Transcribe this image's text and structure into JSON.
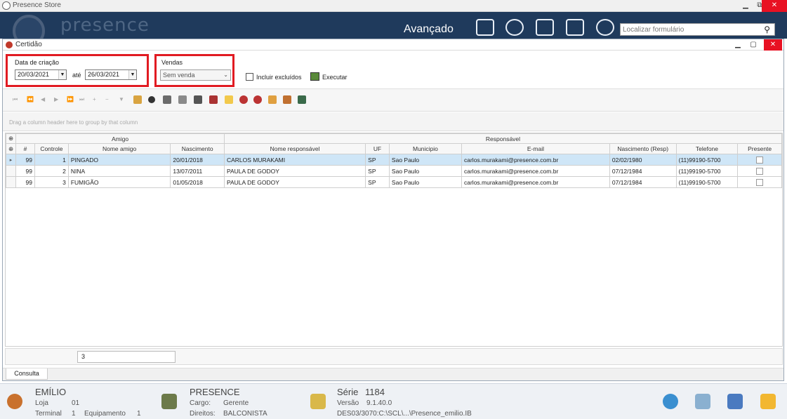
{
  "app": {
    "title": "Presence Store",
    "logo_text": "presence",
    "minimize": "▁",
    "restore": "⧉",
    "close": "✕"
  },
  "header": {
    "section_label": "Avançado",
    "search_placeholder": "Localizar formulário",
    "icons": [
      "news-icon",
      "help-icon",
      "users-icon",
      "network-icon",
      "settings-icon"
    ]
  },
  "window": {
    "title": "Certidão",
    "minimize": "▁",
    "maximize": "▢",
    "close": "✕"
  },
  "filters": {
    "date_group_label": "Data de criação",
    "date_from": "20/03/2021",
    "date_sep": "até",
    "date_to": "26/03/2021",
    "sales_group_label": "Vendas",
    "sales_value": "Sem venda",
    "include_deleted_label": "Incluir excluídos",
    "include_deleted_checked": false,
    "execute_label": "Executar"
  },
  "toolbar": {
    "nav_glyphs": [
      "⏮",
      "⏪",
      "◀",
      "▶",
      "⏩",
      "⏭",
      "+",
      "−",
      "▼"
    ]
  },
  "group_panel_hint": "Drag a column header here to group by that column",
  "grid": {
    "bands": [
      {
        "label": "Amigo"
      },
      {
        "label": "Responsável"
      }
    ],
    "columns": [
      "#",
      "Controle",
      "Nome amigo",
      "Nascimento",
      "Nome responsável",
      "UF",
      "Municipio",
      "E-mail",
      "Nascimento (Resp)",
      "Telefone",
      "Presente"
    ],
    "rows": [
      {
        "num": "99",
        "controle": "1",
        "nome": "PINGADO",
        "nasc": "20/01/2018",
        "resp": "CARLOS MURAKAMI",
        "uf": "SP",
        "mun": "Sao Paulo",
        "email": "carlos.murakami@presence.com.br",
        "nasc_resp": "02/02/1980",
        "tel": "(11)99190-5700",
        "selected": true
      },
      {
        "num": "99",
        "controle": "2",
        "nome": "NINA",
        "nasc": "13/07/2011",
        "resp": "PAULA DE GODOY",
        "uf": "SP",
        "mun": "Sao Paulo",
        "email": "carlos.murakami@presence.com.br",
        "nasc_resp": "07/12/1984",
        "tel": "(11)99190-5700",
        "selected": false
      },
      {
        "num": "99",
        "controle": "3",
        "nome": "FUMIGÃO",
        "nasc": "01/05/2018",
        "resp": "PAULA DE GODOY",
        "uf": "SP",
        "mun": "Sao Paulo",
        "email": "carlos.murakami@presence.com.br",
        "nasc_resp": "07/12/1984",
        "tel": "(11)99190-5700",
        "selected": false
      }
    ],
    "row_count": "3"
  },
  "tabs": [
    {
      "label": "Consulta"
    }
  ],
  "statusbar": {
    "user_name": "EMÍLIO",
    "loja_label": "Loja",
    "loja_value": "01",
    "terminal_label": "Terminal",
    "terminal_value": "1",
    "equip_label": "Equipamento",
    "equip_value": "1",
    "company": "PRESENCE",
    "cargo_label": "Cargo:",
    "cargo_value": "Gerente",
    "direitos_label": "Direitos:",
    "direitos_value": "BALCONISTA",
    "serie_label": "Série",
    "serie_value": "1184",
    "versao_label": "Versão",
    "versao_value": "9.1.40.0",
    "db_path": "DES03/3070:C:\\SCL\\...\\Presence_emilio.IB"
  },
  "colors": {
    "header_bg": "#1f3a5c",
    "highlight_box": "#e11b22",
    "selected_row": "#cfe6f7"
  }
}
